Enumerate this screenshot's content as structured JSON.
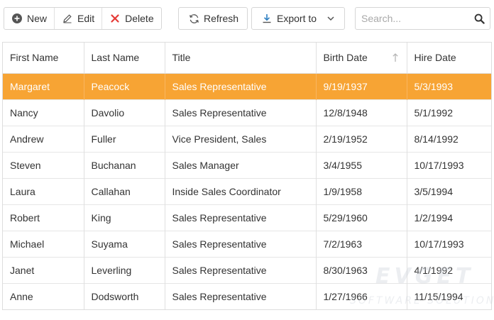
{
  "toolbar": {
    "new_label": "New",
    "edit_label": "Edit",
    "delete_label": "Delete",
    "refresh_label": "Refresh",
    "export_label": "Export to",
    "icons": {
      "new": "plus-circle-icon",
      "edit": "pencil-icon",
      "delete": "x-icon",
      "refresh": "refresh-icon",
      "export": "download-icon",
      "export_dropdown": "chevron-down-icon"
    },
    "delete_icon_color": "#e53935"
  },
  "search": {
    "placeholder": "Search...",
    "value": "",
    "icon": "search-icon"
  },
  "grid": {
    "columns": [
      {
        "label": "First Name"
      },
      {
        "label": "Last Name"
      },
      {
        "label": "Title"
      },
      {
        "label": "Birth Date",
        "sorted": "ascending"
      },
      {
        "label": "Hire Date"
      }
    ],
    "selected_row": 0,
    "selection_color": "#f7a434",
    "rows": [
      [
        "Margaret",
        "Peacock",
        "Sales Representative",
        "9/19/1937",
        "5/3/1993"
      ],
      [
        "Nancy",
        "Davolio",
        "Sales Representative",
        "12/8/1948",
        "5/1/1992"
      ],
      [
        "Andrew",
        "Fuller",
        "Vice President, Sales",
        "2/19/1952",
        "8/14/1992"
      ],
      [
        "Steven",
        "Buchanan",
        "Sales Manager",
        "3/4/1955",
        "10/17/1993"
      ],
      [
        "Laura",
        "Callahan",
        "Inside Sales Coordinator",
        "1/9/1958",
        "3/5/1994"
      ],
      [
        "Robert",
        "King",
        "Sales Representative",
        "5/29/1960",
        "1/2/1994"
      ],
      [
        "Michael",
        "Suyama",
        "Sales Representative",
        "7/2/1963",
        "10/17/1993"
      ],
      [
        "Janet",
        "Leverling",
        "Sales Representative",
        "8/30/1963",
        "4/1/1992"
      ],
      [
        "Anne",
        "Dodsworth",
        "Sales Representative",
        "1/27/1966",
        "11/15/1994"
      ]
    ]
  },
  "watermark": {
    "title": "EVGET",
    "subtitle": "SOFTWARE SOLUTIONS"
  }
}
